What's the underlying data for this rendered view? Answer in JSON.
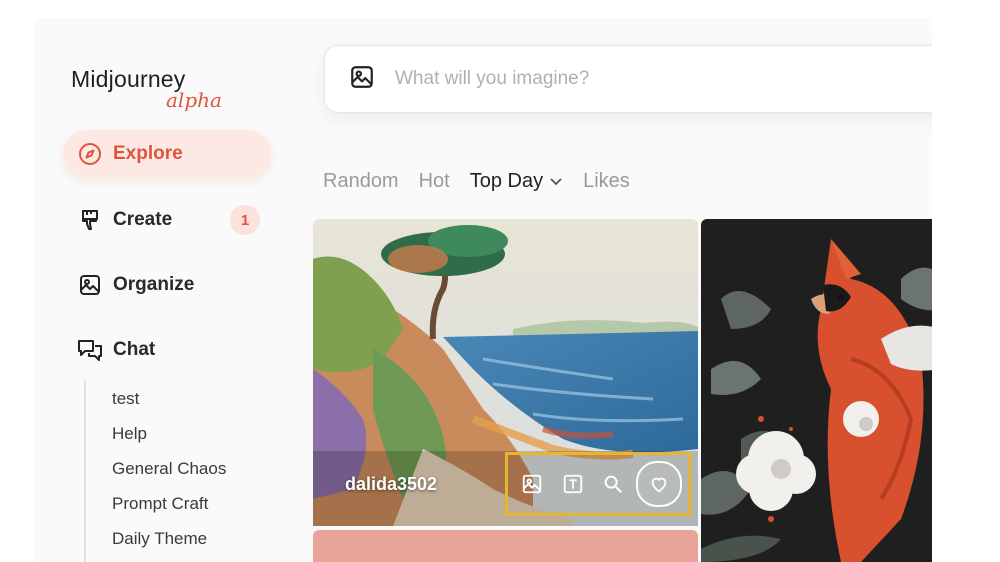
{
  "brand": {
    "name": "Midjourney",
    "tag": "alpha"
  },
  "search": {
    "placeholder": "What will you imagine?",
    "value": ""
  },
  "nav": [
    {
      "label": "Explore",
      "icon": "compass-icon",
      "active": true
    },
    {
      "label": "Create",
      "icon": "brush-icon",
      "badge": "1"
    },
    {
      "label": "Organize",
      "icon": "image-icon"
    },
    {
      "label": "Chat",
      "icon": "chat-icon"
    }
  ],
  "channels": [
    "test",
    "Help",
    "General Chaos",
    "Prompt Craft",
    "Daily Theme"
  ],
  "tabs": [
    {
      "label": "Random"
    },
    {
      "label": "Hot"
    },
    {
      "label": "Top Day",
      "active": true,
      "has_dropdown": true
    },
    {
      "label": "Likes"
    }
  ],
  "gallery": [
    {
      "author": "dalida3502",
      "actions": [
        "image-prompt-icon",
        "text-prompt-icon",
        "search-icon",
        "heart-icon"
      ]
    }
  ],
  "colors": {
    "accent": "#e0533d",
    "highlight": "#e8b531"
  }
}
